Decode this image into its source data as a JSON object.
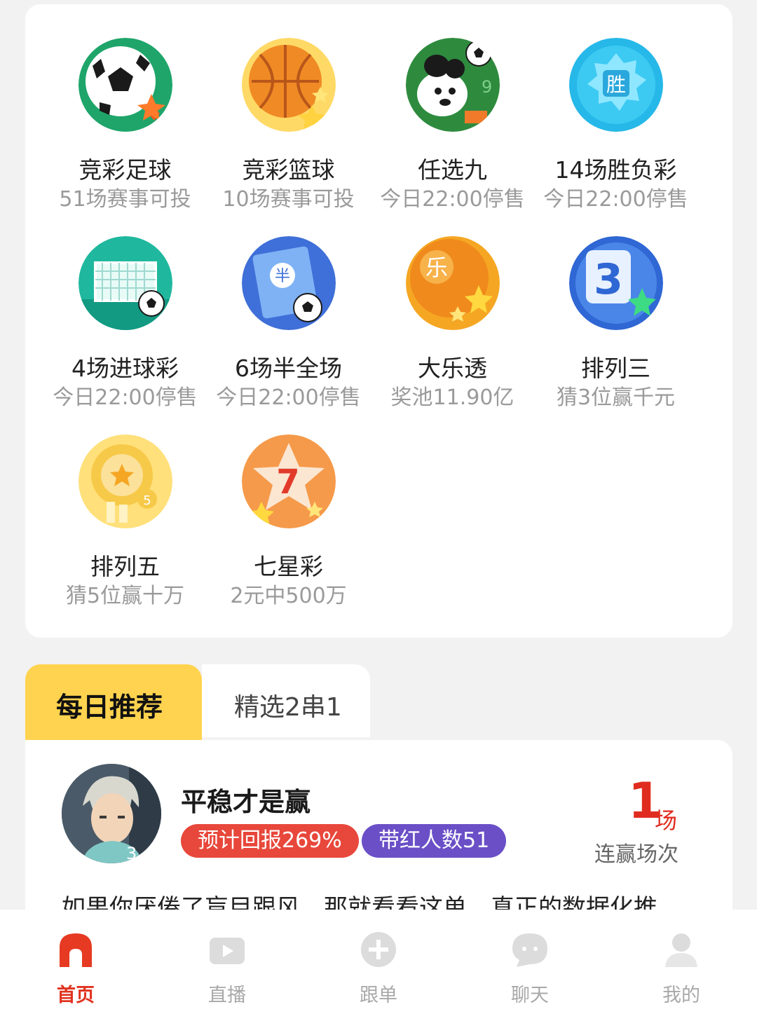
{
  "lotteries": [
    {
      "name": "竞彩足球",
      "sub": "51场赛事可投",
      "icon": "soccer-ball-icon"
    },
    {
      "name": "竞彩篮球",
      "sub": "10场赛事可投",
      "icon": "basketball-icon"
    },
    {
      "name": "任选九",
      "sub": "今日22:00停售",
      "icon": "mascot-soccer-icon"
    },
    {
      "name": "14场胜负彩",
      "sub": "今日22:00停售",
      "icon": "win-badge-icon"
    },
    {
      "name": "4场进球彩",
      "sub": "今日22:00停售",
      "icon": "goal-net-icon"
    },
    {
      "name": "6场半全场",
      "sub": "今日22:00停售",
      "icon": "half-field-icon"
    },
    {
      "name": "大乐透",
      "sub": "奖池11.90亿",
      "icon": "le-ball-icon"
    },
    {
      "name": "排列三",
      "sub": "猜3位赢千元",
      "icon": "number-three-icon"
    },
    {
      "name": "排列五",
      "sub": "猜5位赢十万",
      "icon": "gold-star-coin-icon"
    },
    {
      "name": "七星彩",
      "sub": "2元中500万",
      "icon": "seven-star-icon"
    }
  ],
  "tabs": {
    "active": "每日推荐",
    "inactive": "精选2串1"
  },
  "recommendation": {
    "name": "平稳才是赢",
    "return_pill": "预计回报269%",
    "winners_pill": "带红人数51",
    "streak_number": "1",
    "streak_unit": "场",
    "streak_label": "连赢场次",
    "description": "如果你厌倦了盲目跟风，那就看看这单，真正的数据化推"
  },
  "nav": [
    {
      "label": "首页",
      "icon": "home-icon",
      "active": true
    },
    {
      "label": "直播",
      "icon": "live-video-icon",
      "active": false
    },
    {
      "label": "跟单",
      "icon": "plus-circle-icon",
      "active": false
    },
    {
      "label": "聊天",
      "icon": "chat-bubble-icon",
      "active": false
    },
    {
      "label": "我的",
      "icon": "user-icon",
      "active": false
    }
  ],
  "colors": {
    "accent": "#e0331f",
    "tab_yellow": "#ffd34f",
    "pill_red": "#e8473b",
    "pill_purple": "#6a4fc7"
  }
}
